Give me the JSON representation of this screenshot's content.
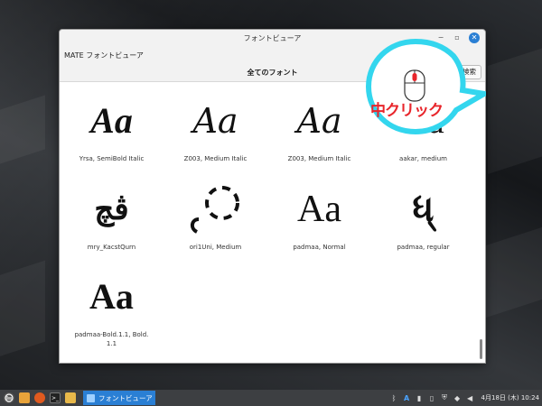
{
  "window": {
    "title": "フォントビューア",
    "menu_label": "MATE フォントビューア",
    "header_title": "全てのフォント",
    "search_label": "検索",
    "minimize_glyph": "−",
    "maximize_glyph": "▫",
    "close_glyph": "✕"
  },
  "fonts": [
    {
      "sample": "Aa",
      "name": "Yrsa, SemiBold Italic"
    },
    {
      "sample": "Aa",
      "name": "Z003, Medium Italic"
    },
    {
      "sample": "Aa",
      "name": "Z003, Medium Italic"
    },
    {
      "sample": "Aa",
      "name": "aakar, medium"
    },
    {
      "sample": "ڤچ",
      "name": "mry_KacstQurn"
    },
    {
      "sample": "",
      "name": "ori1Uni, Medium"
    },
    {
      "sample": "Aa",
      "name": "padmaa, Normal"
    },
    {
      "sample": "ધ્",
      "name": "padmaa, regular"
    },
    {
      "sample": "Aa",
      "name": "padmaa-Bold.1.1, Bold.\n1.1"
    }
  ],
  "annotation": {
    "label": "中クリック",
    "ring_color": "#33d6ee",
    "label_color": "#e8252b"
  },
  "taskbar": {
    "task_label": "フォントビューア",
    "clock": "4月18日 (木) 10:24",
    "accent": "#2a7fd4"
  },
  "icons": [
    "mate-menu-icon",
    "file-manager-icon",
    "firefox-icon",
    "terminal-icon",
    "folder-icon",
    "bluetooth-icon",
    "accessibility-icon",
    "clipboard-icon",
    "shield-icon",
    "network-icon",
    "volume-icon"
  ]
}
